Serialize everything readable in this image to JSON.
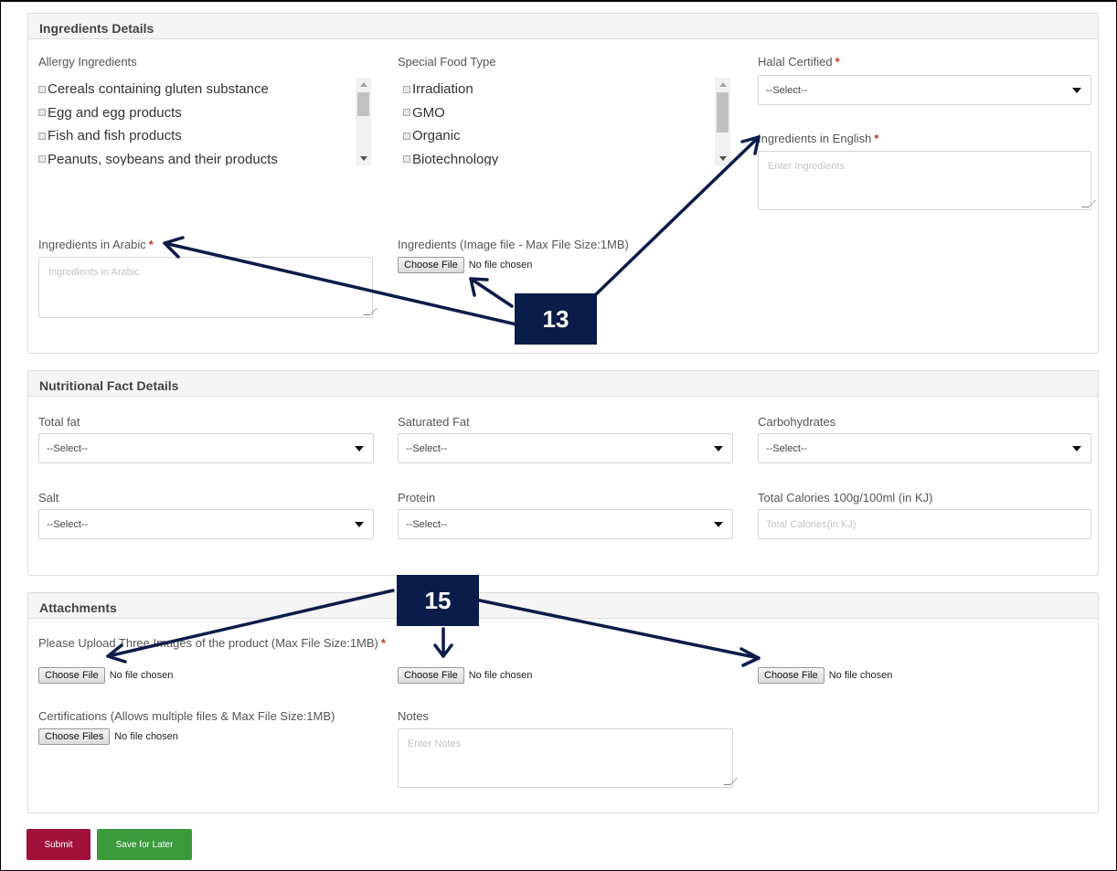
{
  "ingredients": {
    "heading": "Ingredients Details",
    "allergy_label": "Allergy Ingredients",
    "allergy_items": [
      "Cereals containing gluten substance",
      "Egg and egg products",
      "Fish and fish products",
      "Peanuts, soybeans and their products"
    ],
    "special_label": "Special Food Type",
    "special_items": [
      "Irradiation",
      "GMO",
      "Organic",
      "Biotechnology"
    ],
    "halal_label": "Halal Certified",
    "halal_value": "--Select--",
    "english_label": "Ingredients in English",
    "english_placeholder": "Enter Ingredients",
    "arabic_label": "Ingredients in Arabic",
    "arabic_placeholder": "Ingredients in Arabic",
    "image_label": "Ingredients (Image file - Max File Size:1MB)",
    "file_button": "Choose File",
    "no_file": "No file chosen"
  },
  "nutrition": {
    "heading": "Nutritional Fact Details",
    "total_fat_label": "Total fat",
    "saturated_fat_label": "Saturated Fat",
    "carbohydrates_label": "Carbohydrates",
    "salt_label": "Salt",
    "protein_label": "Protein",
    "calories_label": "Total Calories 100g/100ml (in KJ)",
    "calories_placeholder": "Total Calories(in KJ)",
    "select_value": "--Select--"
  },
  "attachments": {
    "heading": "Attachments",
    "images_label": "Please Upload Three Images of the product (Max File Size:1MB)",
    "file_button": "Choose File",
    "files_button": "Choose Files",
    "no_file": "No file chosen",
    "certifications_label": "Certifications (Allows multiple files & Max File Size:1MB)",
    "notes_label": "Notes",
    "notes_placeholder": "Enter Notes"
  },
  "actions": {
    "submit_label": "Submit",
    "save_later_label": "Save for Later",
    "submit_color": "#a0103a",
    "save_color": "#3a9a3c"
  },
  "callouts": {
    "step_13": "13",
    "step_15": "15",
    "callout_color": "#0b1c4a"
  }
}
